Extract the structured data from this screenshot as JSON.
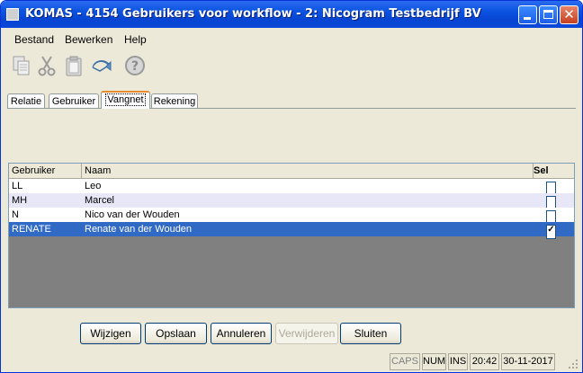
{
  "window": {
    "title": "KOMAS - 4154 Gebruikers voor workflow - 2: Nicogram Testbedrijf BV",
    "minimize_label": "",
    "maximize_label": "",
    "close_label": "✕"
  },
  "menu": {
    "items": [
      "Bestand",
      "Bewerken",
      "Help"
    ]
  },
  "toolbar": {
    "icons": [
      "copy-icon",
      "cut-icon",
      "paste-icon",
      "undo-icon",
      "help-icon"
    ]
  },
  "tabs": {
    "items": [
      "Relatie",
      "Gebruiker",
      "Vangnet",
      "Rekening"
    ],
    "active": "Vangnet"
  },
  "table": {
    "columns": [
      "Gebruiker",
      "Naam",
      "Sel"
    ],
    "rows": [
      {
        "gebruiker": "LL",
        "naam": "Leo",
        "sel": false
      },
      {
        "gebruiker": "MH",
        "naam": "Marcel",
        "sel": false
      },
      {
        "gebruiker": "N",
        "naam": "Nico van der Wouden",
        "sel": false
      },
      {
        "gebruiker": "RENATE",
        "naam": "Renate van der Wouden",
        "sel": true
      }
    ],
    "selected_row": 3,
    "check_mark": "✓"
  },
  "buttons": {
    "wijzigen": "Wijzigen",
    "opslaan": "Opslaan",
    "annuleren": "Annuleren",
    "verwijderen": "Verwijderen",
    "sluiten": "Sluiten"
  },
  "statusbar": {
    "caps": "CAPS",
    "num": "NUM",
    "ins": "INS",
    "time": "20:42",
    "date": "30-11-2017"
  },
  "colors": {
    "titlebar": "#0a52e0",
    "selection": "#316ac5",
    "alt_row": "#e7e7f8",
    "grid_empty": "#808080"
  }
}
